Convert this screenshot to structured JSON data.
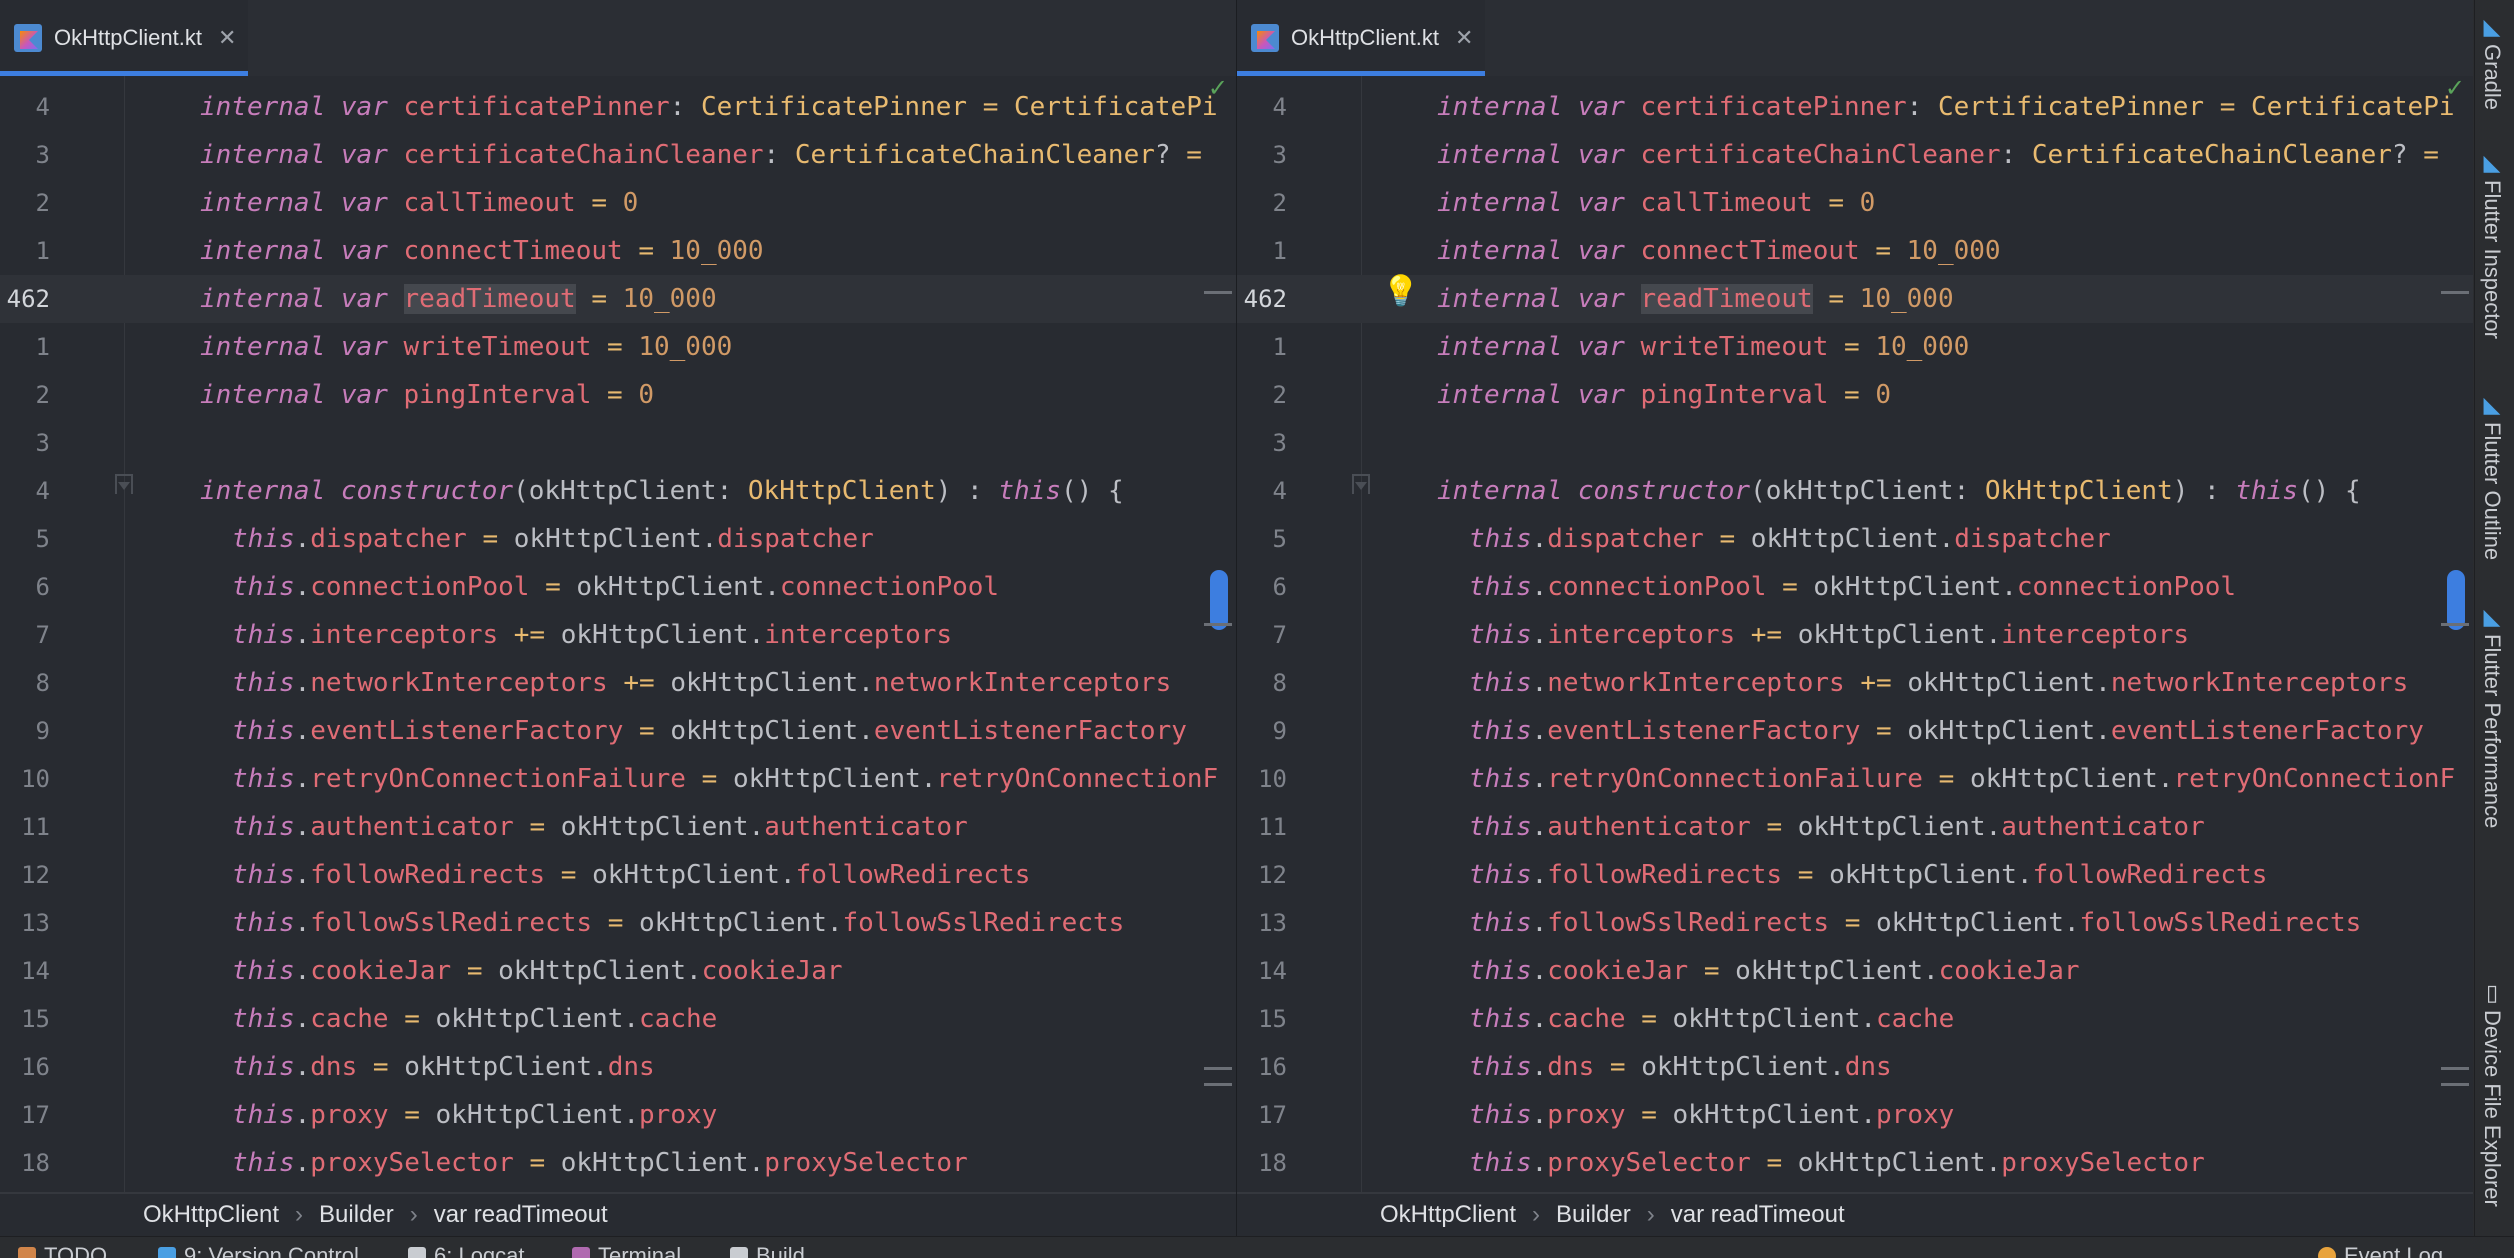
{
  "tab": {
    "file_name": "OkHttpClient.kt",
    "close_glyph": "✕"
  },
  "status": {
    "check_glyph": "✓"
  },
  "current_line_number": "462",
  "code_lines": [
    {
      "n": "4",
      "text": "internal var certificatePinner: CertificatePinner = CertificatePi"
    },
    {
      "n": "3",
      "text": "internal var certificateChainCleaner: CertificateChainCleaner? ="
    },
    {
      "n": "2",
      "text": "internal var callTimeout = 0"
    },
    {
      "n": "1",
      "text": "internal var connectTimeout = 10_000"
    },
    {
      "n": "462",
      "text": "internal var readTimeout = 10_000"
    },
    {
      "n": "1",
      "text": "internal var writeTimeout = 10_000"
    },
    {
      "n": "2",
      "text": "internal var pingInterval = 0"
    },
    {
      "n": "3",
      "text": ""
    },
    {
      "n": "4",
      "text": "internal constructor(okHttpClient: OkHttpClient) : this() {"
    },
    {
      "n": "5",
      "text": "this.dispatcher = okHttpClient.dispatcher"
    },
    {
      "n": "6",
      "text": "this.connectionPool = okHttpClient.connectionPool"
    },
    {
      "n": "7",
      "text": "this.interceptors += okHttpClient.interceptors"
    },
    {
      "n": "8",
      "text": "this.networkInterceptors += okHttpClient.networkInterceptors"
    },
    {
      "n": "9",
      "text": "this.eventListenerFactory = okHttpClient.eventListenerFactory"
    },
    {
      "n": "10",
      "text": "this.retryOnConnectionFailure = okHttpClient.retryOnConnectionF"
    },
    {
      "n": "11",
      "text": "this.authenticator = okHttpClient.authenticator"
    },
    {
      "n": "12",
      "text": "this.followRedirects = okHttpClient.followRedirects"
    },
    {
      "n": "13",
      "text": "this.followSslRedirects = okHttpClient.followSslRedirects"
    },
    {
      "n": "14",
      "text": "this.cookieJar = okHttpClient.cookieJar"
    },
    {
      "n": "15",
      "text": "this.cache = okHttpClient.cache"
    },
    {
      "n": "16",
      "text": "this.dns = okHttpClient.dns"
    },
    {
      "n": "17",
      "text": "this.proxy = okHttpClient.proxy"
    },
    {
      "n": "18",
      "text": "this.proxySelector = okHttpClient.proxySelector"
    }
  ],
  "breadcrumb": {
    "items": [
      "OkHttpClient",
      "Builder",
      "var readTimeout"
    ],
    "separator": "›"
  },
  "right_tools": [
    {
      "label": "Gradle",
      "icon": "gradle-icon"
    },
    {
      "label": "Flutter Inspector",
      "icon": "flutter-icon"
    },
    {
      "label": "Flutter Outline",
      "icon": "flutter-icon"
    },
    {
      "label": "Flutter Performance",
      "icon": "flutter-icon"
    },
    {
      "label": "Device File Explorer",
      "icon": "device-icon"
    }
  ],
  "bottom_tools": [
    {
      "label": "TODO",
      "icon": "todo-icon"
    },
    {
      "label": "9: Version Control",
      "icon": "vcs-icon"
    },
    {
      "label": "6: Logcat",
      "icon": "logcat-icon"
    },
    {
      "label": "Terminal",
      "icon": "terminal-icon"
    },
    {
      "label": "Build",
      "icon": "build-icon"
    },
    {
      "label": "Event Log",
      "icon": "event-log-icon"
    }
  ],
  "colors": {
    "editor_bg": "#282b31",
    "keyword": "#c77dbb",
    "type": "#e8ba70",
    "field": "#e06c75",
    "number": "#d19a66",
    "accent": "#3d7ee0"
  }
}
